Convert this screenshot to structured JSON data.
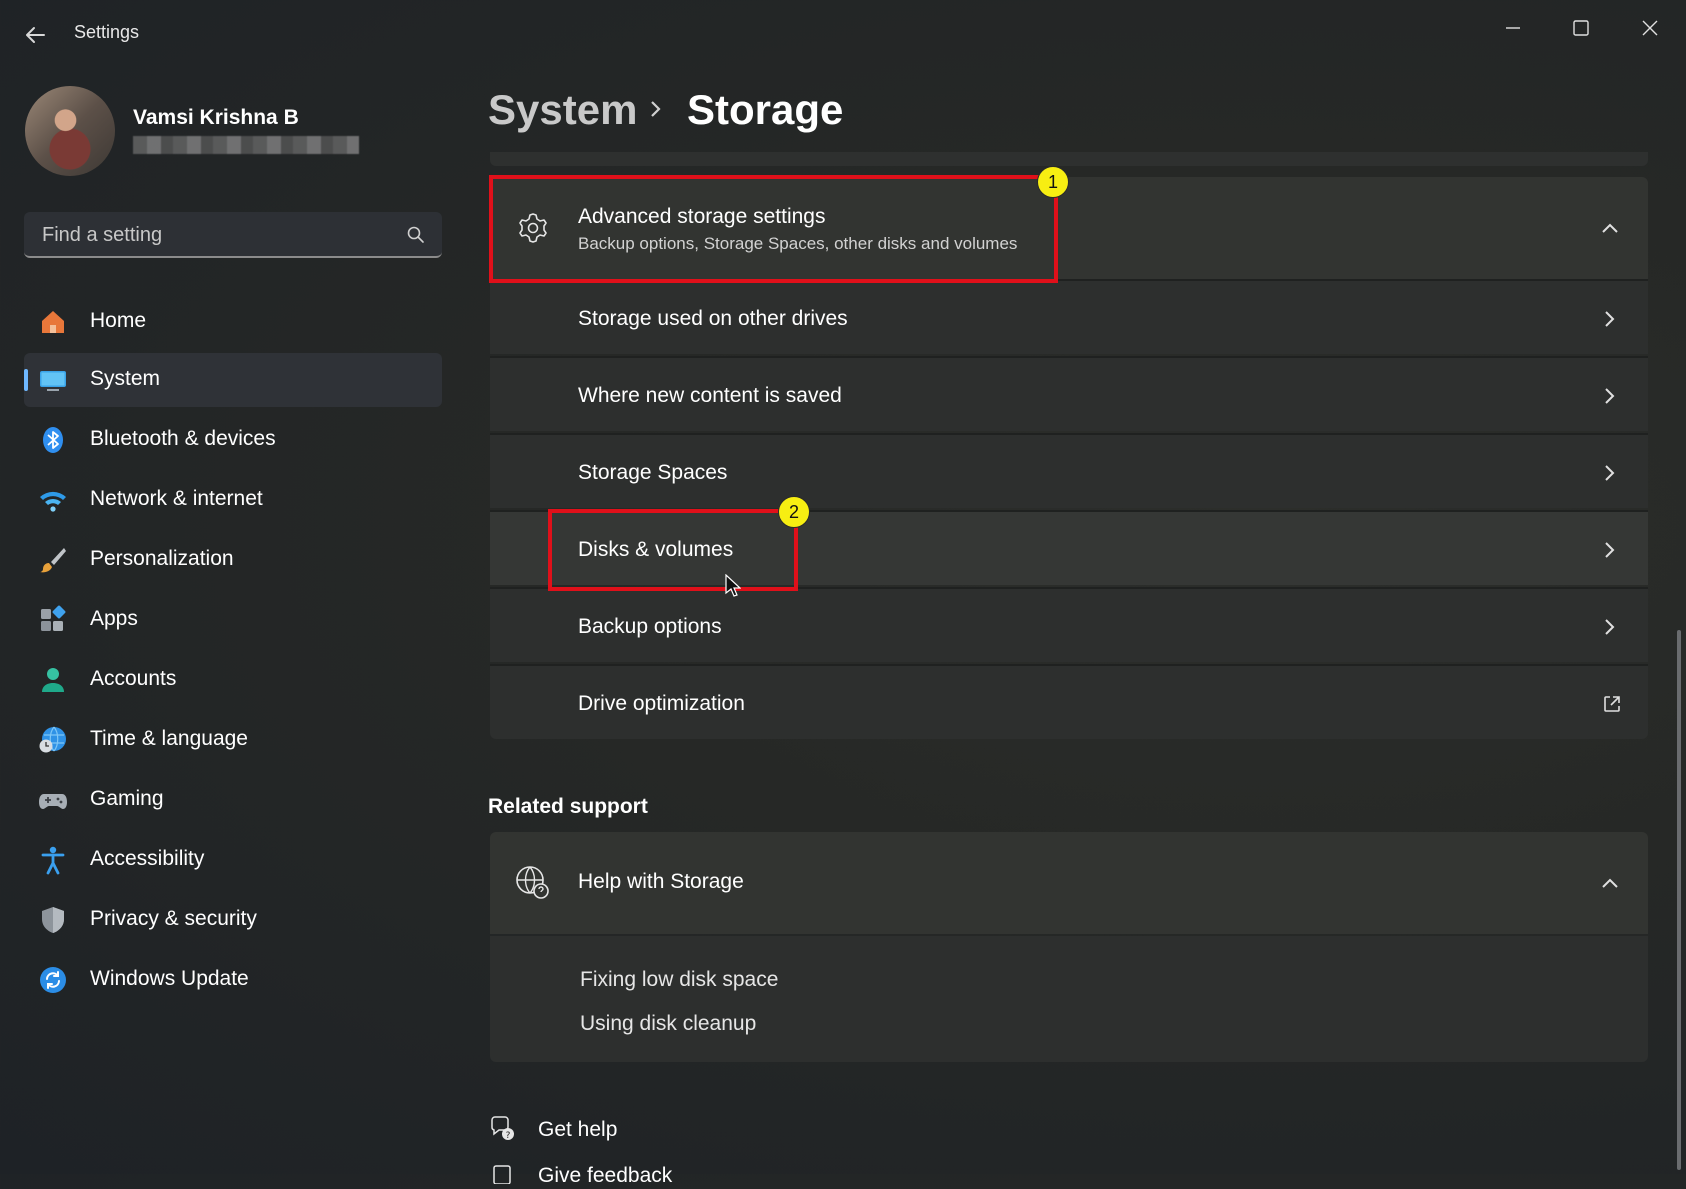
{
  "window": {
    "title": "Settings"
  },
  "profile": {
    "name": "Vamsi Krishna B"
  },
  "search": {
    "placeholder": "Find a setting"
  },
  "nav": {
    "items": [
      {
        "label": "Home",
        "icon": "home-icon"
      },
      {
        "label": "System",
        "icon": "monitor-icon",
        "active": true
      },
      {
        "label": "Bluetooth & devices",
        "icon": "bluetooth-icon"
      },
      {
        "label": "Network & internet",
        "icon": "wifi-icon"
      },
      {
        "label": "Personalization",
        "icon": "brush-icon"
      },
      {
        "label": "Apps",
        "icon": "apps-icon"
      },
      {
        "label": "Accounts",
        "icon": "person-icon"
      },
      {
        "label": "Time & language",
        "icon": "globe-clock-icon"
      },
      {
        "label": "Gaming",
        "icon": "gamepad-icon"
      },
      {
        "label": "Accessibility",
        "icon": "accessibility-icon"
      },
      {
        "label": "Privacy & security",
        "icon": "shield-icon"
      },
      {
        "label": "Windows Update",
        "icon": "update-icon"
      }
    ]
  },
  "breadcrumb": {
    "parent": "System",
    "current": "Storage"
  },
  "advanced": {
    "title": "Advanced storage settings",
    "subtitle": "Backup options, Storage Spaces, other disks and volumes",
    "expanded": true,
    "items": [
      {
        "label": "Storage used on other drives"
      },
      {
        "label": "Where new content is saved"
      },
      {
        "label": "Storage Spaces"
      },
      {
        "label": "Disks & volumes"
      },
      {
        "label": "Backup options"
      },
      {
        "label": "Drive optimization",
        "external": true
      }
    ]
  },
  "annotations": {
    "badge1": "1",
    "badge2": "2",
    "color": "#e0101a",
    "badge_color": "#f7ee12"
  },
  "related": {
    "heading": "Related support",
    "help_title": "Help with Storage",
    "links": [
      "Fixing low disk space",
      "Using disk cleanup"
    ]
  },
  "footer": {
    "get_help": "Get help",
    "give_feedback": "Give feedback"
  },
  "colors": {
    "accent": "#6fb8ff",
    "background": "#1f2328",
    "card": "#2d2f2e"
  }
}
